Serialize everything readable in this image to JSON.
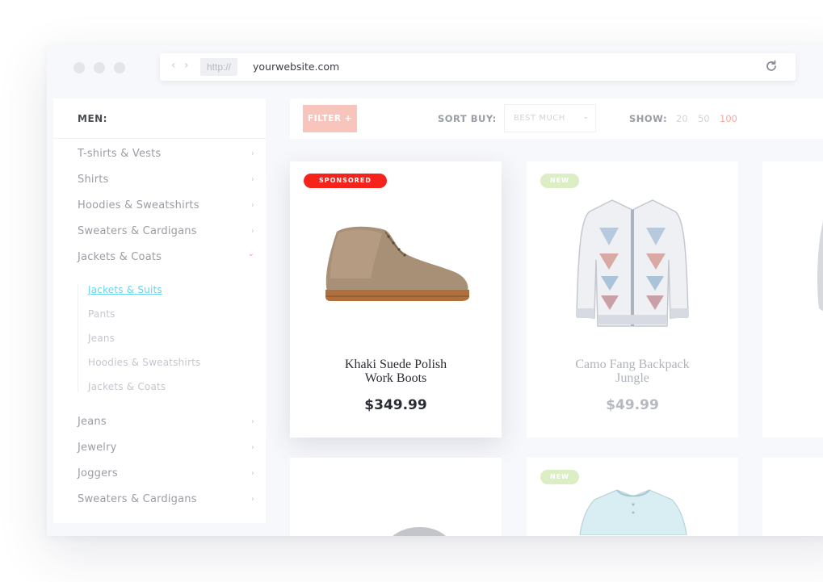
{
  "browser": {
    "protocol": "http://",
    "url": "yourwebsite.com",
    "nav_back": "‹",
    "nav_forward": "›"
  },
  "sidebar": {
    "title": "MEN:",
    "categories_top": [
      {
        "label": "T-shirts & Vests"
      },
      {
        "label": "Shirts"
      },
      {
        "label": "Hoodies & Sweatshirts"
      },
      {
        "label": "Sweaters & Cardigans"
      },
      {
        "label": "Jackets & Coats"
      }
    ],
    "subcategories": [
      {
        "label": "Jackets & Suits"
      },
      {
        "label": "Pants"
      },
      {
        "label": "Jeans"
      },
      {
        "label": "Hoodies & Sweatshirts"
      },
      {
        "label": "Jackets & Coats"
      }
    ],
    "categories_bottom": [
      {
        "label": "Jeans"
      },
      {
        "label": "Jewelry"
      },
      {
        "label": "Joggers"
      },
      {
        "label": "Sweaters & Cardigans"
      }
    ],
    "chevron": "›",
    "chevron_open": "⌄"
  },
  "toolbar": {
    "filter_label": "FILTER +",
    "sort_label": "SORT BUY:",
    "sort_value": "BEST MUCH",
    "sort_chevron": "⌄",
    "show_label": "SHOW:",
    "show_options": [
      "20",
      "50",
      "100"
    ],
    "show_selected": "100"
  },
  "products": [
    {
      "badge": "SPONSORED",
      "name_line1": "Khaki Suede Polish",
      "name_line2": "Work Boots",
      "price": "$349.99"
    },
    {
      "badge": "NEW",
      "name_line1": "Camo Fang Backpack",
      "name_line2": "Jungle",
      "price": "$49.99"
    },
    {
      "badge": "NEW"
    }
  ],
  "colors": {
    "accent": "#f8a89a",
    "sponsored": "#f5231c",
    "new_badge": "#dcefc4",
    "link_active": "#6dd3e6"
  }
}
